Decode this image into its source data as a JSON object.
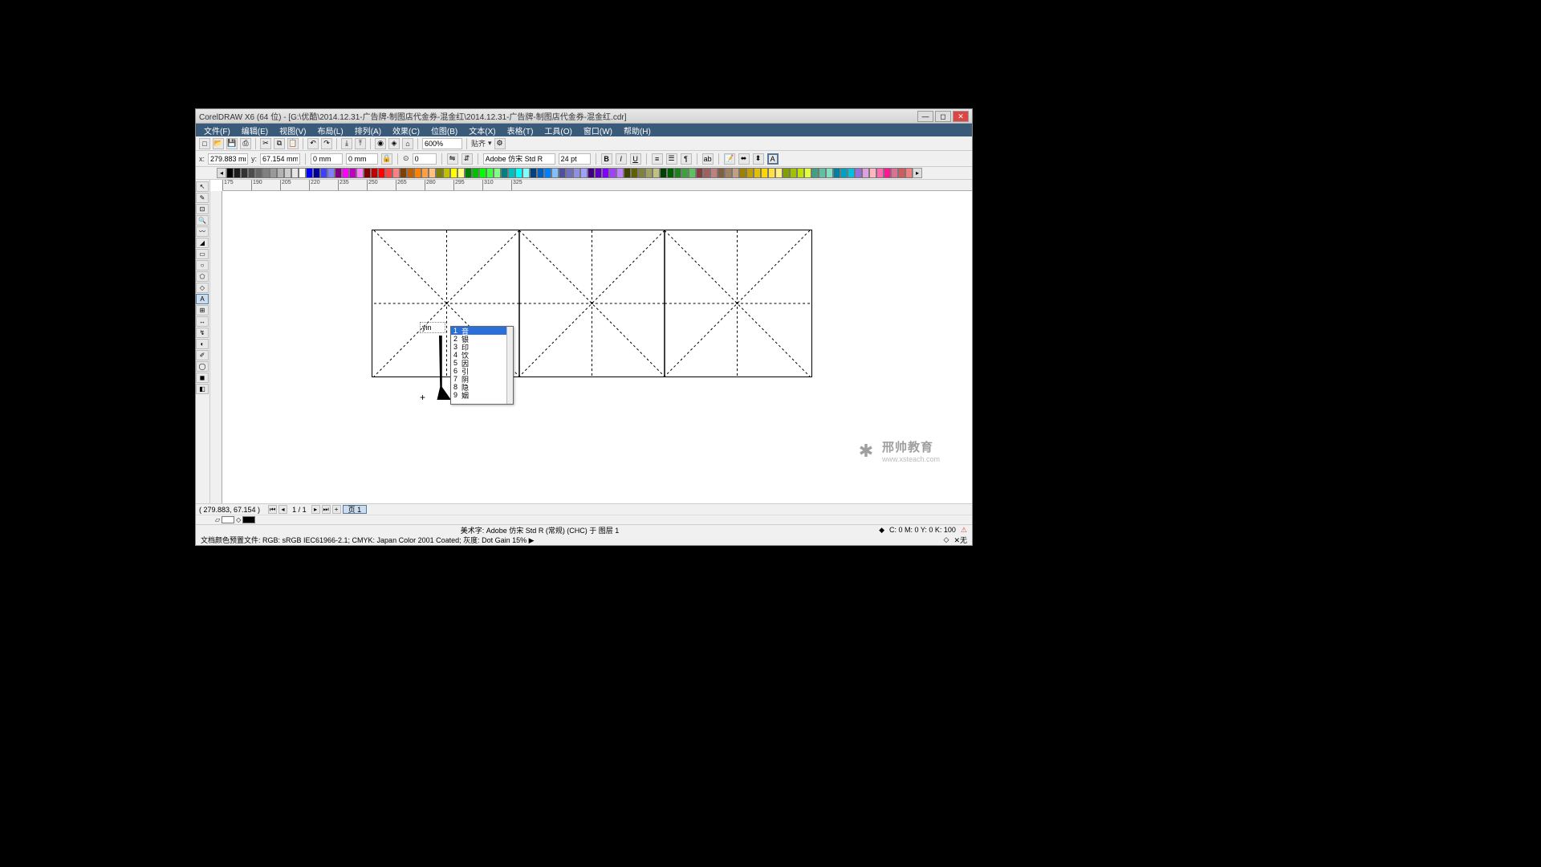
{
  "title": "CorelDRAW X6 (64 位) - [G:\\优酷\\2014.12.31-广告牌-制图店代金券-混金红\\2014.12.31-广告牌-制图店代金券-混金红.cdr]",
  "menu": {
    "file": "文件(F)",
    "edit": "编辑(E)",
    "view": "视图(V)",
    "layout": "布局(L)",
    "arrange": "排列(A)",
    "effects": "效果(C)",
    "bitmaps": "位图(B)",
    "text": "文本(X)",
    "table": "表格(T)",
    "tools": "工具(O)",
    "window": "窗口(W)",
    "help": "帮助(H)"
  },
  "toolbar1": {
    "zoom": "600%",
    "snap": "贴齐"
  },
  "toolbar2": {
    "x_label": "x:",
    "x": "279.883 mm",
    "y_label": "y:",
    "y": "67.154 mm",
    "w": "0 mm",
    "h": "0 mm",
    "angle": "0",
    "font": "Adobe 仿宋 Std R",
    "size": "24 pt"
  },
  "ruler_ticks_h": [
    "175",
    "190",
    "205",
    "220",
    "235",
    "250",
    "265",
    "280",
    "295",
    "310",
    "325"
  ],
  "page_nav": {
    "current": "1 / 1",
    "tab": "页 1"
  },
  "ime": {
    "input": "yin",
    "items": [
      {
        "n": "1",
        "c": "音"
      },
      {
        "n": "2",
        "c": "银"
      },
      {
        "n": "3",
        "c": "印"
      },
      {
        "n": "4",
        "c": "饮"
      },
      {
        "n": "5",
        "c": "因"
      },
      {
        "n": "6",
        "c": "引"
      },
      {
        "n": "7",
        "c": "阴"
      },
      {
        "n": "8",
        "c": "隐"
      },
      {
        "n": "9",
        "c": "姻"
      }
    ]
  },
  "status1_coords": "( 279.883, 67.154 )",
  "status1_center": "美术字: Adobe 仿宋 Std R (常规) (CHC) 于 图层 1",
  "status1_right_cmyk": "C: 0 M: 0 Y: 0 K: 100",
  "status2_left": "文档颜色预置文件: RGB: sRGB IEC61966-2.1; CMYK: Japan Color 2001 Coated; 灰度: Dot Gain 15% ▶",
  "status2_right": "✕无",
  "watermark": {
    "main": "邢帅教育",
    "sub": "www.xsteach.com"
  },
  "palette": [
    "#000000",
    "#1a1a1a",
    "#333333",
    "#4d4d4d",
    "#666666",
    "#808080",
    "#999999",
    "#b3b3b3",
    "#cccccc",
    "#e6e6e6",
    "#ffffff",
    "#0000ff",
    "#000099",
    "#4040ff",
    "#8080ff",
    "#800080",
    "#ff00ff",
    "#c000c0",
    "#ff80ff",
    "#800000",
    "#c00000",
    "#ff0000",
    "#ff4040",
    "#ff8080",
    "#804000",
    "#c06000",
    "#ff8000",
    "#ffa040",
    "#ffc080",
    "#808000",
    "#c0c000",
    "#ffff00",
    "#ffff80",
    "#008000",
    "#00c000",
    "#00ff00",
    "#40ff40",
    "#80ff80",
    "#008080",
    "#00c0c0",
    "#00ffff",
    "#80ffff",
    "#004080",
    "#0060c0",
    "#0080ff",
    "#80c0ff",
    "#5050a0",
    "#7070c0",
    "#9090e0",
    "#a0a0ff",
    "#400080",
    "#6000c0",
    "#8000ff",
    "#a040ff",
    "#c080ff",
    "#404000",
    "#606000",
    "#808040",
    "#a0a060",
    "#c0c080",
    "#004000",
    "#006000",
    "#208020",
    "#40a040",
    "#60c060",
    "#804040",
    "#a06060",
    "#c08080",
    "#806040",
    "#a08060",
    "#c0a080",
    "#a08000",
    "#c0a000",
    "#e0c000",
    "#ffd700",
    "#ffe040",
    "#fff080",
    "#80a000",
    "#a0c000",
    "#c0e000",
    "#e0ff40",
    "#40a080",
    "#60c0a0",
    "#80e0c0",
    "#0080a0",
    "#00a0c0",
    "#00c0e0",
    "#9370db",
    "#dda0dd",
    "#ffb6c1",
    "#ff69b4",
    "#ff1493",
    "#db7093",
    "#cd5c5c",
    "#f08080"
  ]
}
